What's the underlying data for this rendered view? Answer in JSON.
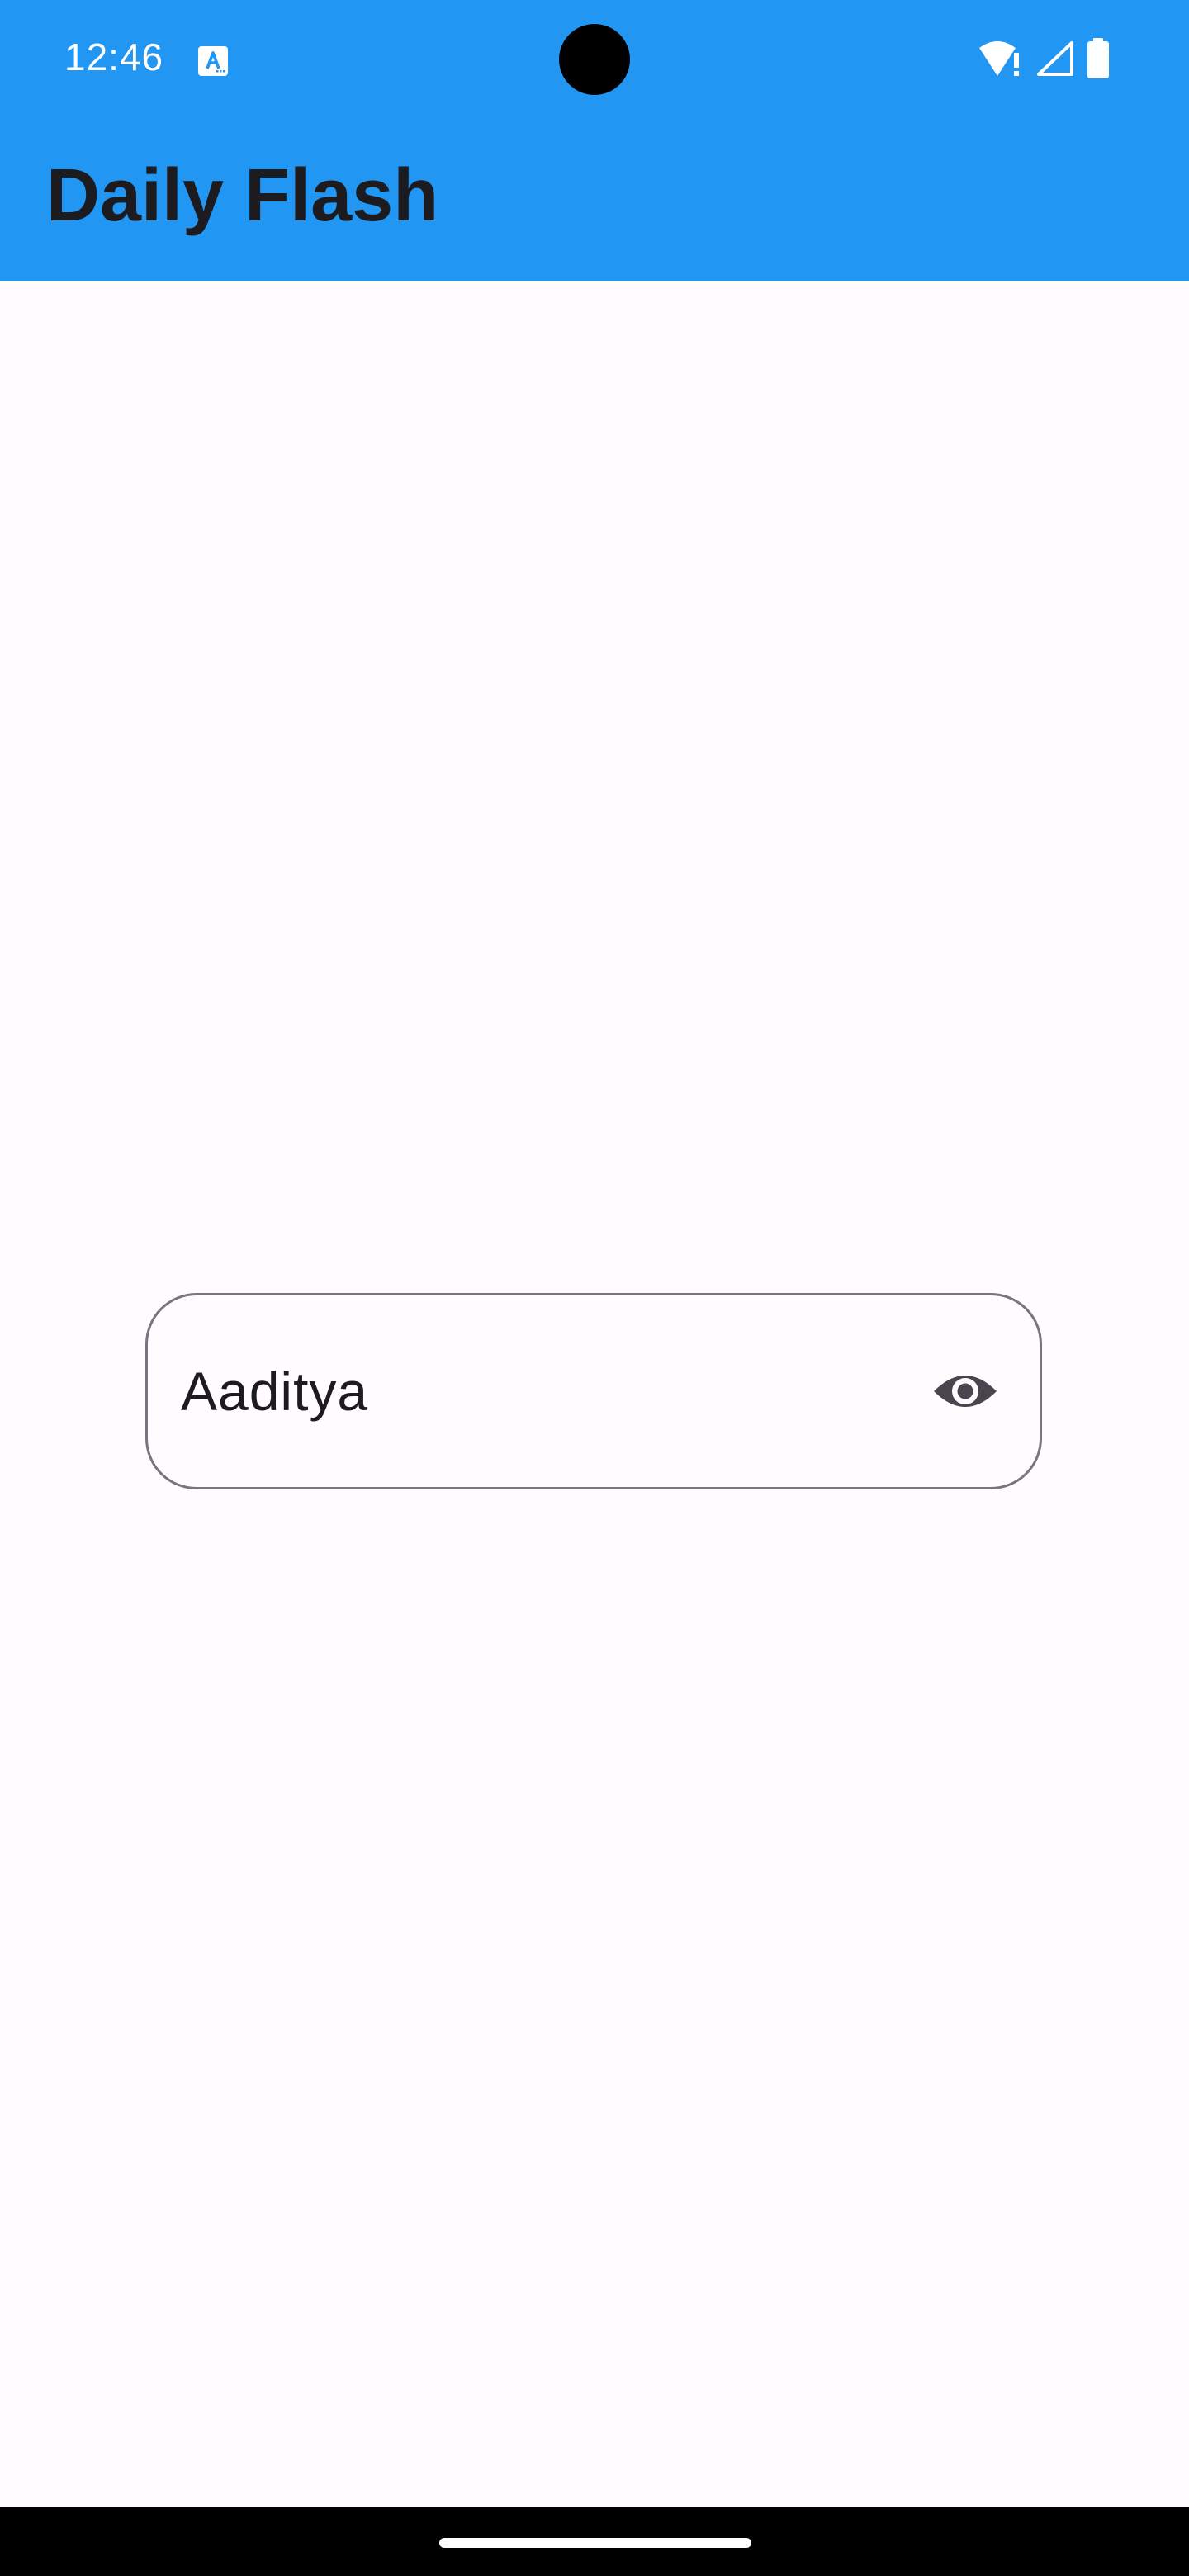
{
  "status_bar": {
    "time": "12:46",
    "app_notification_icon": "text-a-icon",
    "icons": [
      "wifi-alert-icon",
      "cellular-signal-icon",
      "battery-full-icon"
    ]
  },
  "app_bar": {
    "title": "Daily Flash",
    "background_color": "#2196f3"
  },
  "name_field": {
    "value": "Aaditya",
    "trailing_icon": "eye-visibility-icon"
  },
  "nav_bar": {
    "gesture": "home-indicator"
  }
}
